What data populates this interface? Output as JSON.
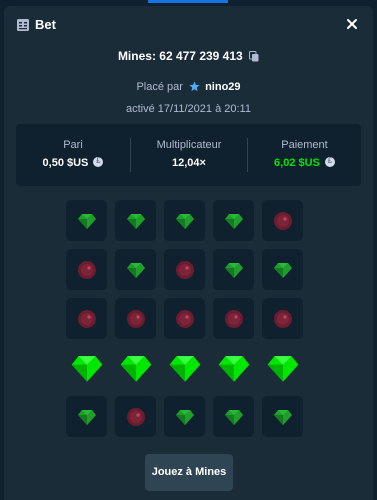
{
  "window": {
    "title": "Bet",
    "close_label": "×"
  },
  "game": {
    "title": "Mines: 62 477 239 413",
    "placed_prefix": "Placé par",
    "username": "nino29",
    "activated": "activé 17/11/2021 à 20:11"
  },
  "stats": {
    "bet_label": "Pari",
    "bet_value": "0,50 $US",
    "multiplier_label": "Multiplicateur",
    "multiplier_value": "12,04×",
    "payout_label": "Paiement",
    "payout_value": "6,02 $US"
  },
  "grid": {
    "rows": [
      [
        "gem",
        "gem",
        "gem",
        "gem",
        "mine"
      ],
      [
        "mine",
        "gem",
        "mine",
        "gem",
        "gem"
      ],
      [
        "mine",
        "mine",
        "mine",
        "mine",
        "mine"
      ],
      [
        "gem-revealed",
        "gem-revealed",
        "gem-revealed",
        "gem-revealed",
        "gem-revealed"
      ],
      [
        "gem",
        "mine",
        "gem",
        "gem",
        "gem"
      ]
    ]
  },
  "play_button": "Jouez à Mines",
  "colors": {
    "background": "#0f212e",
    "panel": "#1a2c38",
    "accent_green": "#00e701",
    "mine": "#6b1c30",
    "muted_text": "#b1bad3"
  },
  "icons": {
    "header": "bet-slip-icon",
    "close": "close-icon",
    "copy": "copy-icon",
    "user": "vip-star-icon",
    "currency": "coin-icon"
  }
}
